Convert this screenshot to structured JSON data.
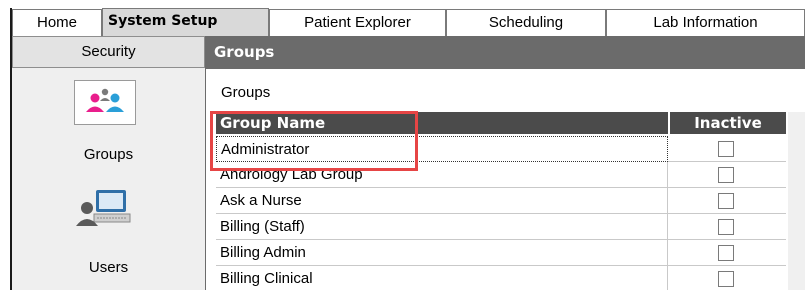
{
  "tabs": [
    {
      "label": "Home"
    },
    {
      "label": "System Setup",
      "active": true
    },
    {
      "label": "Patient Explorer"
    },
    {
      "label": "Scheduling"
    },
    {
      "label": "Lab Information"
    }
  ],
  "sidebar": {
    "header": "Security",
    "items": [
      {
        "label": "Groups",
        "icon": "groups-icon",
        "selected": true
      },
      {
        "label": "Users",
        "icon": "users-computer-icon"
      }
    ]
  },
  "main": {
    "title": "Groups",
    "section_label": "Groups",
    "table": {
      "columns": [
        "Group Name",
        "Inactive"
      ],
      "rows": [
        {
          "name": "Administrator",
          "inactive": false,
          "selected": true
        },
        {
          "name": "Andrology Lab Group",
          "inactive": false
        },
        {
          "name": "Ask a Nurse",
          "inactive": false
        },
        {
          "name": "Billing (Staff)",
          "inactive": false
        },
        {
          "name": "Billing Admin",
          "inactive": false
        },
        {
          "name": "Billing Clinical",
          "inactive": false
        }
      ]
    }
  },
  "colors": {
    "highlight_box": "#e64545",
    "title_bar": "#6b6b6b",
    "grid_header": "#4b4b4b",
    "group_icon_pink": "#e91e8c",
    "group_icon_blue": "#2a9fd8"
  }
}
